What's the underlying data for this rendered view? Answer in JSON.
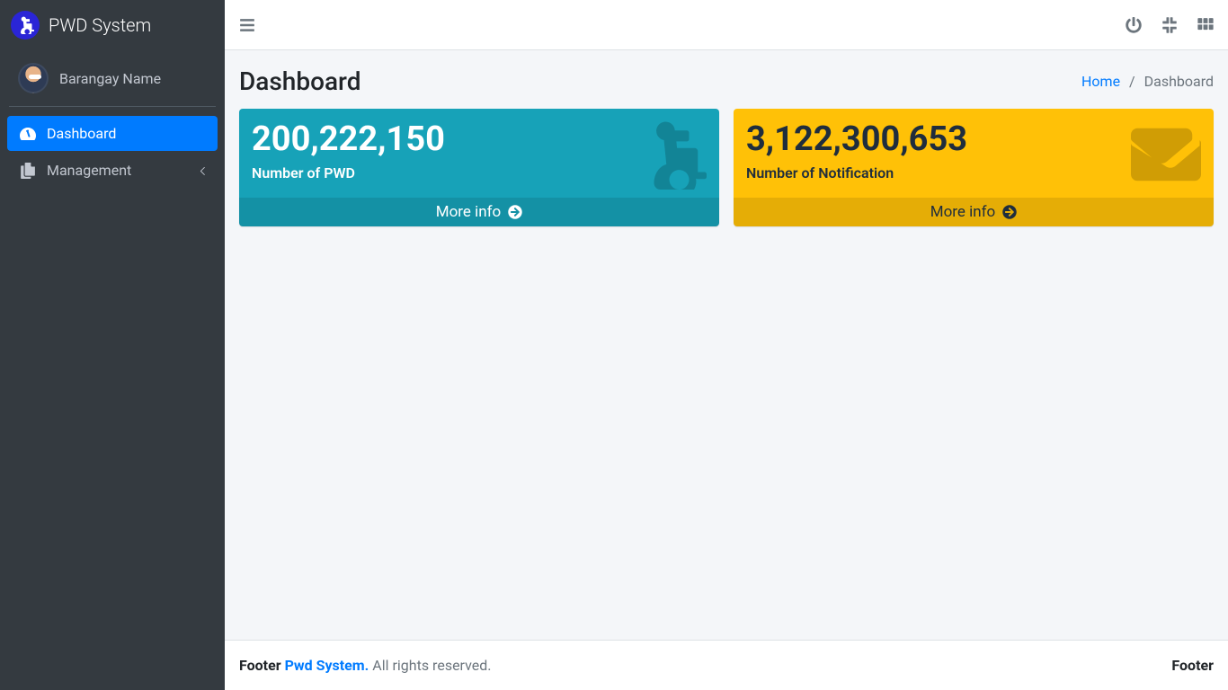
{
  "brand": {
    "text": "PWD System"
  },
  "user": {
    "name": "Barangay Name"
  },
  "sidebar": {
    "items": [
      {
        "label": "Dashboard"
      },
      {
        "label": "Management"
      }
    ]
  },
  "header": {
    "title": "Dashboard",
    "breadcrumb": {
      "home": "Home",
      "current": "Dashboard"
    }
  },
  "cards": [
    {
      "value": "200,222,150",
      "label": "Number of PWD",
      "more": "More info"
    },
    {
      "value": "3,122,300,653",
      "label": "Number of Notification",
      "more": "More info"
    }
  ],
  "footer": {
    "left_prefix": "Footer ",
    "brand_link": "Pwd System.",
    "left_suffix": " All rights reserved.",
    "right": "Footer"
  }
}
